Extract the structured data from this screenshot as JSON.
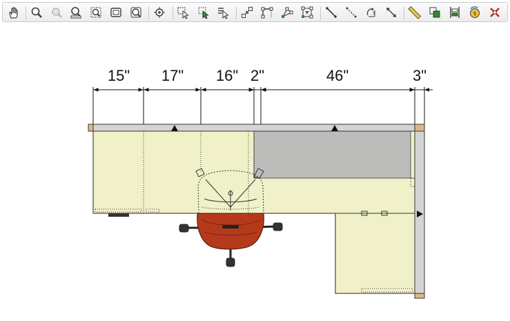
{
  "toolbar": {
    "tools": [
      {
        "name": "pan-hand-icon",
        "glyph": "hand"
      },
      {
        "name": "zoom-icon",
        "glyph": "zoom"
      },
      {
        "name": "zoom-out-icon",
        "glyph": "zoomout"
      },
      {
        "name": "zoom-fill-icon",
        "glyph": "zoomfill"
      },
      {
        "name": "zoom-window-icon",
        "glyph": "zoomwin"
      },
      {
        "name": "zoom-extents-icon",
        "glyph": "zoomext"
      },
      {
        "name": "zoom-previous-icon",
        "glyph": "zoomprev"
      },
      {
        "name": "center-view-icon",
        "glyph": "center"
      },
      {
        "name": "select-arrow-icon",
        "glyph": "select"
      },
      {
        "name": "marquee-select-icon",
        "glyph": "marquee"
      },
      {
        "name": "select-list-icon",
        "glyph": "selectlist"
      },
      {
        "name": "edit-points-icon",
        "glyph": "points"
      },
      {
        "name": "edit-corner-icon",
        "glyph": "corner"
      },
      {
        "name": "edit-shape-icon",
        "glyph": "shape"
      },
      {
        "name": "edit-handles-icon",
        "glyph": "handles"
      },
      {
        "name": "draw-line-icon",
        "glyph": "line"
      },
      {
        "name": "dashed-line-icon",
        "glyph": "dashline"
      },
      {
        "name": "rotate-3d-icon",
        "glyph": "rot3"
      },
      {
        "name": "dimension-icon",
        "glyph": "dimension"
      },
      {
        "name": "measure-ruler-icon",
        "glyph": "ruler"
      },
      {
        "name": "copy-objects-icon",
        "glyph": "copy"
      },
      {
        "name": "align-objects-icon",
        "glyph": "align"
      },
      {
        "name": "pricing-icon",
        "glyph": "price",
        "label": "$"
      },
      {
        "name": "delete-icon",
        "glyph": "delete"
      }
    ]
  },
  "dimensions": [
    {
      "label": "15\"",
      "value": 15
    },
    {
      "label": "17\"",
      "value": 17
    },
    {
      "label": "16\"",
      "value": 16
    },
    {
      "label": "2\"",
      "value": 2
    },
    {
      "label": "46\"",
      "value": 46
    },
    {
      "label": "3\"",
      "value": 3
    }
  ],
  "colors": {
    "worksurface": "#f1f1c9",
    "panel": "#d4d4d4",
    "storage": "#bcbdbb",
    "panel_end": "#ddb884",
    "chair_seat": "#b53a1c",
    "chair_seat_dark": "#8e2a12",
    "line": "#222222",
    "toolbar_icon": "#3a3a3a",
    "toolbar_accent": "#2f8a2f",
    "delete_red": "#c8201c"
  }
}
